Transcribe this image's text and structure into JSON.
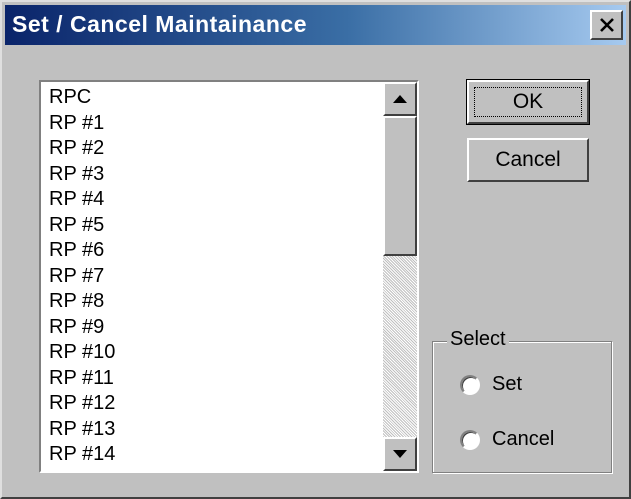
{
  "window": {
    "title": "Set / Cancel Maintainance"
  },
  "titlebar": {
    "close_icon": "close-icon"
  },
  "list": {
    "items": [
      "RPC",
      "RP #1",
      "RP #2",
      "RP #3",
      "RP #4",
      "RP #5",
      "RP #6",
      "RP #7",
      "RP #8",
      "RP #9",
      "RP #10",
      "RP #11",
      "RP #12",
      "RP #13",
      "RP #14"
    ],
    "scroll_up_icon": "scroll-up-arrow-icon",
    "scroll_down_icon": "scroll-down-arrow-icon"
  },
  "buttons": {
    "ok_label": "OK",
    "cancel_label": "Cancel"
  },
  "select_group": {
    "label": "Select",
    "options": [
      {
        "label": "Set",
        "selected": false
      },
      {
        "label": "Cancel",
        "selected": false
      }
    ]
  },
  "colors": {
    "face": "#c0c0c0",
    "title_gradient_start": "#0a246a",
    "title_gradient_end": "#a6caf0",
    "title_text": "#ffffff"
  }
}
